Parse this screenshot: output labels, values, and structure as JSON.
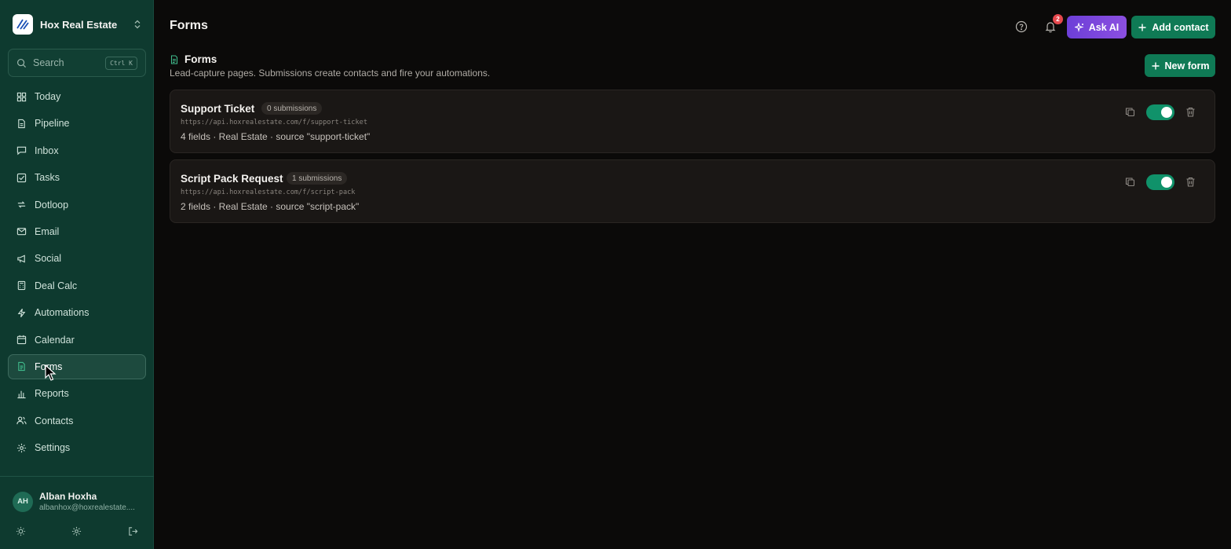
{
  "app": {
    "brand_name": "Hox Real Estate",
    "page_title": "Forms"
  },
  "sidebar": {
    "search_label": "Search",
    "search_shortcut": "Ctrl K",
    "items": [
      {
        "label": "Today",
        "icon": "grid-icon"
      },
      {
        "label": "Pipeline",
        "icon": "document-icon"
      },
      {
        "label": "Inbox",
        "icon": "message-icon"
      },
      {
        "label": "Tasks",
        "icon": "checkbox-icon"
      },
      {
        "label": "Dotloop",
        "icon": "loop-icon"
      },
      {
        "label": "Email",
        "icon": "mail-icon"
      },
      {
        "label": "Social",
        "icon": "megaphone-icon"
      },
      {
        "label": "Deal Calc",
        "icon": "calculator-icon"
      },
      {
        "label": "Automations",
        "icon": "bolt-icon"
      },
      {
        "label": "Calendar",
        "icon": "calendar-icon"
      },
      {
        "label": "Forms",
        "icon": "form-icon",
        "active": true
      },
      {
        "label": "Reports",
        "icon": "bar-chart-icon"
      },
      {
        "label": "Contacts",
        "icon": "users-icon"
      },
      {
        "label": "Settings",
        "icon": "gear-icon"
      }
    ],
    "user": {
      "initials": "AH",
      "name": "Alban Hoxha",
      "email": "albanhox@hoxrealestate...."
    }
  },
  "header": {
    "notification_count": "2",
    "ask_ai_label": "Ask AI",
    "add_contact_label": "Add contact"
  },
  "section": {
    "title": "Forms",
    "description": "Lead-capture pages. Submissions create contacts and fire your automations.",
    "new_form_label": "New form"
  },
  "forms": [
    {
      "name": "Support Ticket",
      "submissions": "0 submissions",
      "url": "https://api.hoxrealestate.com/f/support-ticket",
      "meta": "4 fields · Real Estate · source \"support-ticket\"",
      "enabled": true
    },
    {
      "name": "Script Pack Request",
      "submissions": "1 submissions",
      "url": "https://api.hoxrealestate.com/f/script-pack",
      "meta": "2 fields · Real Estate · source \"script-pack\"",
      "enabled": true
    }
  ],
  "colors": {
    "sidebar_bg": "#0e3a2f",
    "accent_green": "#0f7a55",
    "ai_purple": "#7a45dc",
    "badge_red": "#e5484d"
  }
}
